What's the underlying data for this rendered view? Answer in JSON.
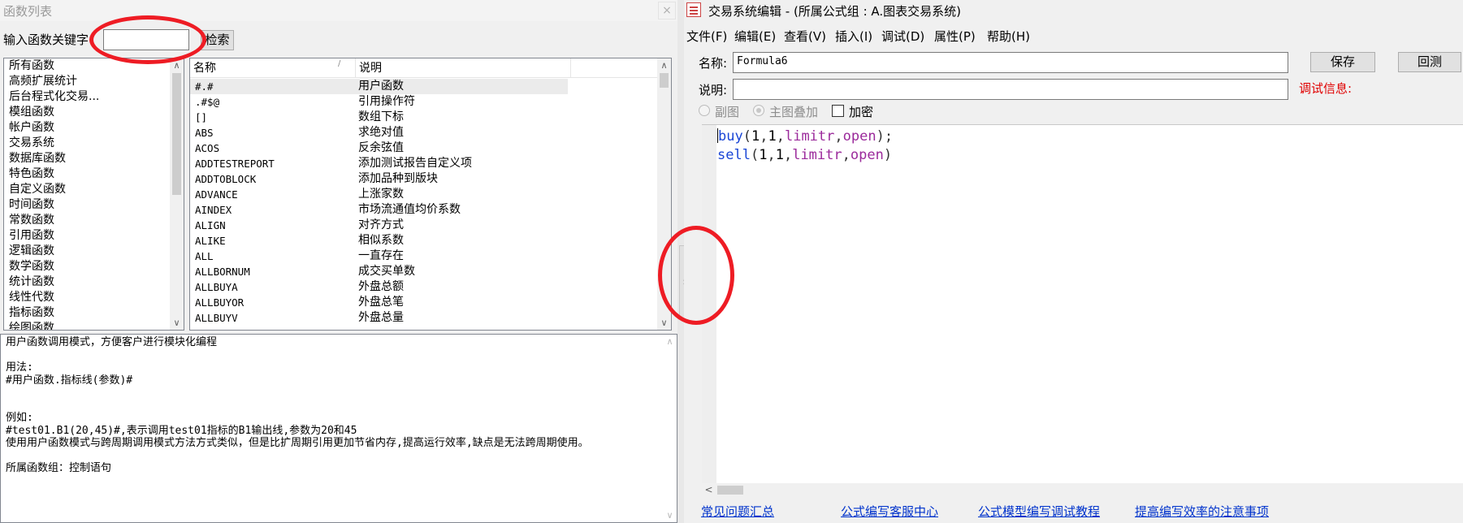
{
  "left_window": {
    "title": "函数列表",
    "close_glyph": "×",
    "keyword_label": "输入函数关键字",
    "keyword_value": "",
    "search_button": "检索",
    "categories": [
      "所有函数",
      "高频扩展统计",
      "后台程式化交易...",
      "模组函数",
      "帐户函数",
      "交易系统",
      "数据库函数",
      "特色函数",
      "自定义函数",
      "时间函数",
      "常数函数",
      "引用函数",
      "逻辑函数",
      "数学函数",
      "统计函数",
      "线性代数",
      "指标函数",
      "绘图函数"
    ],
    "table": {
      "col_name": "名称",
      "col_desc": "说明",
      "sort_glyph": "/",
      "rows": [
        {
          "name": "#.#",
          "desc": "用户函数"
        },
        {
          "name": ".#$@",
          "desc": "引用操作符"
        },
        {
          "name": "[]",
          "desc": "数组下标"
        },
        {
          "name": "ABS",
          "desc": "求绝对值"
        },
        {
          "name": "ACOS",
          "desc": "反余弦值"
        },
        {
          "name": "ADDTESTREPORT",
          "desc": "添加测试报告自定义项"
        },
        {
          "name": "ADDTOBLOCK",
          "desc": "添加品种到版块"
        },
        {
          "name": "ADVANCE",
          "desc": "上涨家数"
        },
        {
          "name": "AINDEX",
          "desc": "市场流通值均价系数"
        },
        {
          "name": "ALIGN",
          "desc": "对齐方式"
        },
        {
          "name": "ALIKE",
          "desc": "相似系数"
        },
        {
          "name": "ALL",
          "desc": "一直存在"
        },
        {
          "name": "ALLBORNUM",
          "desc": "成交买单数"
        },
        {
          "name": "ALLBUYA",
          "desc": "外盘总额"
        },
        {
          "name": "ALLBUYOR",
          "desc": "外盘总笔"
        },
        {
          "name": "ALLBUYV",
          "desc": "外盘总量"
        }
      ]
    },
    "description": "用户函数调用模式，方便客户进行模块化编程\n\n用法:\n#用户函数.指标线(参数)#\n\n\n例如:\n#test01.B1(20,45)#,表示调用test01指标的B1输出线,参数为20和45\n使用用户函数模式与跨周期调用模式方法方式类似，但是比扩周期引用更加节省内存,提高运行效率,缺点是无法跨周期使用。\n\n所属函数组：控制语句"
  },
  "splitter": {
    "glyph": "›"
  },
  "right_window": {
    "title": "交易系统编辑 - (所属公式组 : A.图表交易系统)",
    "menu": [
      "文件(F)",
      "编辑(E)",
      "查看(V)",
      "插入(I)",
      "调试(D)",
      "属性(P)",
      "帮助(H)"
    ],
    "name_label": "名称:",
    "name_value": "Formula6",
    "note_label": "说明:",
    "save_button": "保存",
    "backtest_button": "回测",
    "debug_label": "调试信息:",
    "radio_sub": "副图",
    "radio_main": "主图叠加",
    "encrypt_label": "加密",
    "code": {
      "line1": {
        "fn": "buy",
        "a1": "1",
        "a2": "1",
        "a3": "limitr",
        "a4": "open",
        "end": ";"
      },
      "line2": {
        "fn": "sell",
        "a1": "1",
        "a2": "1",
        "a3": "limitr",
        "a4": "open",
        "end": ""
      }
    },
    "links": [
      "常见问题汇总",
      "公式编写客服中心",
      "公式模型编写调试教程",
      "提高编写效率的注意事项"
    ]
  },
  "colors": {
    "annotation_ring": "#ee1c24",
    "link": "#0033cc",
    "debug_text": "#e00000"
  }
}
